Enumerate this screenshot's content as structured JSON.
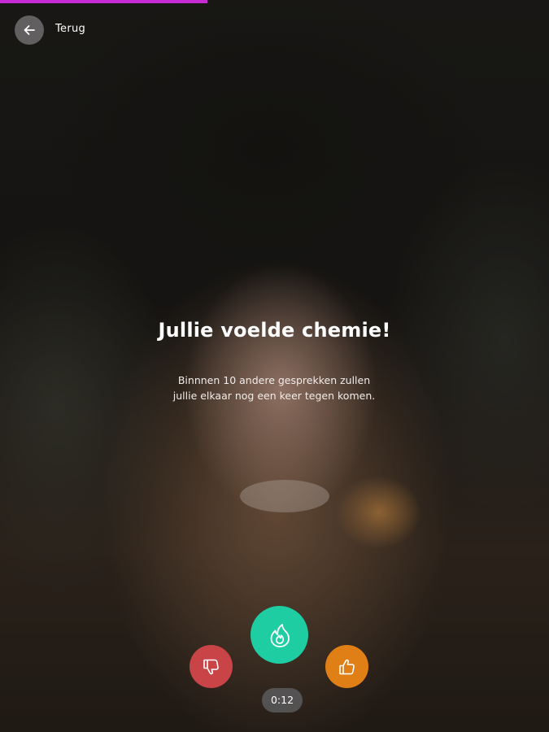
{
  "progress": {
    "fraction": 0.378,
    "color": "#c62ad3"
  },
  "header": {
    "back_label": "Terug",
    "back_icon": "arrow-left-icon"
  },
  "result": {
    "title": "Jullie voelde chemie!",
    "description_line1": "Binnnen 10 andere gesprekken zullen",
    "description_line2": "jullie elkaar nog een keer tegen komen."
  },
  "actions": {
    "dislike": {
      "icon": "thumbs-down-icon",
      "color": "#c84447"
    },
    "chemistry": {
      "icon": "flame-icon",
      "color": "#1fcda3"
    },
    "like": {
      "icon": "thumbs-up-icon",
      "color": "#e07f16"
    }
  },
  "timer": {
    "value": "0:12"
  }
}
